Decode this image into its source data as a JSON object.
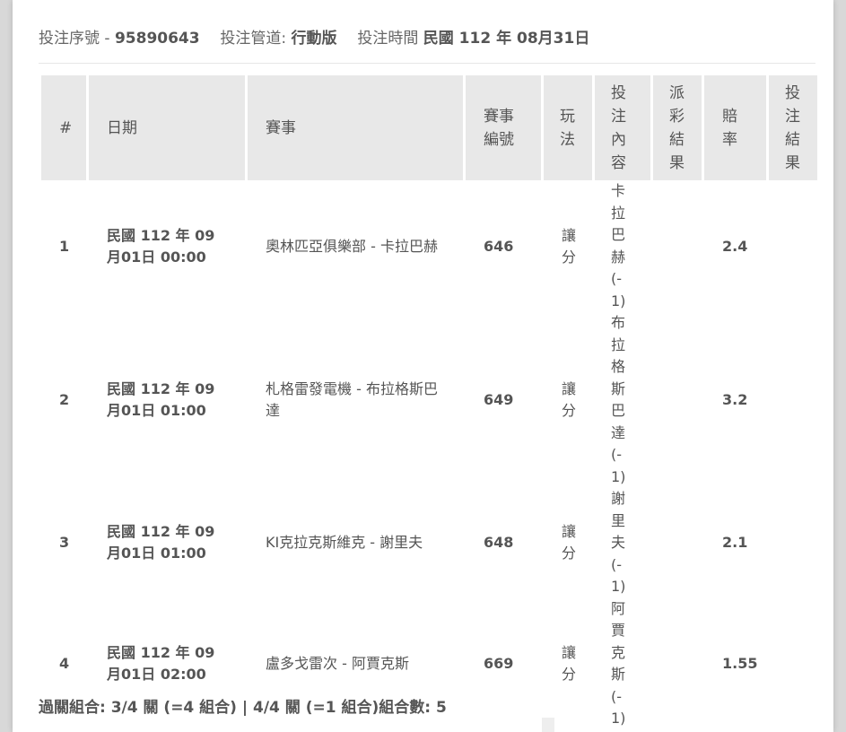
{
  "header": {
    "serial_label": "投注序號 -",
    "serial_value": "95890643",
    "channel_label": "投注管道:",
    "channel_value": "行動版",
    "time_label": "投注時間",
    "time_value": "民國 112 年 08月31日"
  },
  "table": {
    "columns": [
      "#",
      "日期",
      "賽事",
      "賽事編號",
      "玩法",
      "投注內容",
      "派彩結果",
      "賠率",
      "投注結果"
    ],
    "rows": [
      {
        "no": "1",
        "date": "民國 112 年 09月01日 00:00",
        "match": "奧林匹亞俱樂部 - 卡拉巴赫",
        "event_no": "646",
        "play": "讓分",
        "content": "卡拉巴赫(-1)",
        "payout": "",
        "odds": "2.4",
        "result": ""
      },
      {
        "no": "2",
        "date": "民國 112 年 09月01日 01:00",
        "match": "札格雷發電機 - 布拉格斯巴達",
        "event_no": "649",
        "play": "讓分",
        "content": "布拉格斯巴達(-1)",
        "payout": "",
        "odds": "3.2",
        "result": ""
      },
      {
        "no": "3",
        "date": "民國 112 年 09月01日 01:00",
        "match": "KI克拉克斯維克 - 謝里夫",
        "event_no": "648",
        "play": "讓分",
        "content": "謝里夫(-1)",
        "payout": "",
        "odds": "2.1",
        "result": ""
      },
      {
        "no": "4",
        "date": "民國 112 年 09月01日 02:00",
        "match": "盧多戈雷次 - 阿賈克斯",
        "event_no": "669",
        "play": "讓分",
        "content": "阿賈克斯(-1)",
        "payout": "",
        "odds": "1.55",
        "result": ""
      }
    ]
  },
  "footer": {
    "summary": "過關組合: 3/4 關 (=4 組合) | 4/4 關 (=1 組合)組合數: 5"
  }
}
